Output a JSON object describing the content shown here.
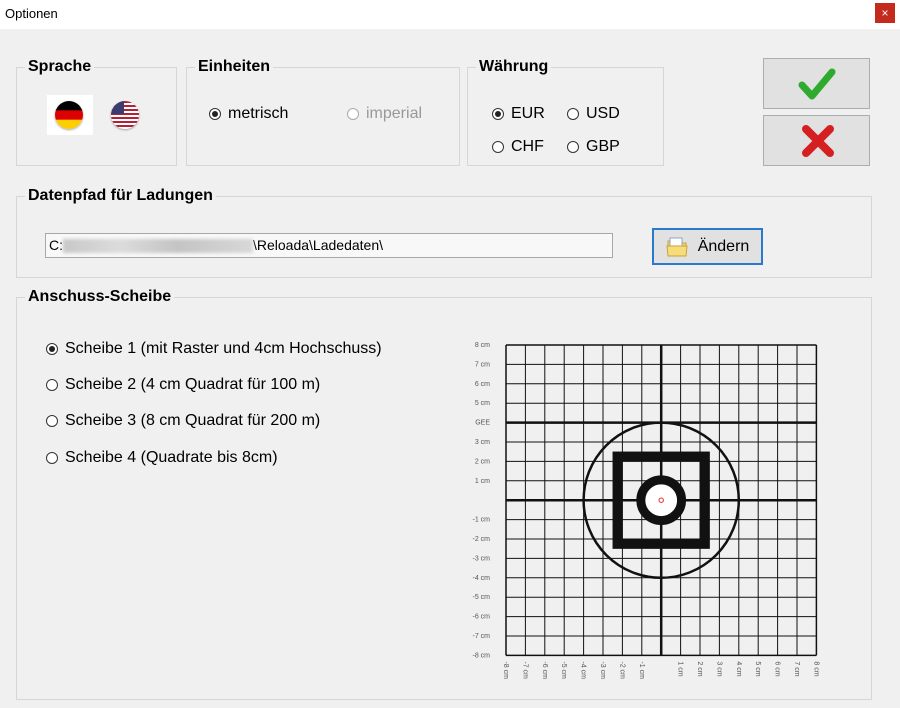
{
  "window": {
    "title": "Optionen",
    "close_glyph": "×"
  },
  "language": {
    "title": "Sprache",
    "flags": [
      {
        "name": "german-flag-icon",
        "colors": [
          "#000000",
          "#dd0000",
          "#ffce00"
        ]
      },
      {
        "name": "us-flag-icon",
        "colors": [
          "#b22234",
          "#ffffff",
          "#3c3b6e"
        ]
      }
    ]
  },
  "units": {
    "title": "Einheiten",
    "options": [
      {
        "label": "metrisch",
        "checked": true,
        "enabled": true
      },
      {
        "label": "imperial",
        "checked": false,
        "enabled": false
      }
    ]
  },
  "currency": {
    "title": "Währung",
    "options": [
      {
        "label": "EUR",
        "checked": true
      },
      {
        "label": "USD",
        "checked": false
      },
      {
        "label": "CHF",
        "checked": false
      },
      {
        "label": "GBP",
        "checked": false
      }
    ]
  },
  "actions": {
    "ok_icon": "checkmark-icon",
    "ok_color": "#2eaa2e",
    "cancel_icon": "x-icon",
    "cancel_color": "#d42020"
  },
  "datapath": {
    "title": "Datenpfad für Ladungen",
    "path_prefix": "C:",
    "path_suffix": "\\Reloada\\Ladedaten\\",
    "change_label": "Ändern",
    "change_icon": "folder-icon"
  },
  "target": {
    "title": "Anschuss-Scheibe",
    "options": [
      {
        "label": "Scheibe 1 (mit Raster und 4cm Hochschuss)",
        "checked": true
      },
      {
        "label": "Scheibe 2 (4 cm Quadrat für 100 m)",
        "checked": false
      },
      {
        "label": "Scheibe 3 (8 cm Quadrat für 200 m)",
        "checked": false
      },
      {
        "label": "Scheibe 4 (Quadrate bis 8cm)",
        "checked": false
      }
    ],
    "preview": {
      "y_labels": [
        "8 cm",
        "7 cm",
        "6 cm",
        "5 cm",
        "GEE",
        "3 cm",
        "2 cm",
        "1 cm",
        "",
        "-1 cm",
        "-2 cm",
        "-3 cm",
        "-4 cm",
        "-5 cm",
        "-6 cm",
        "-7 cm",
        "-8 cm"
      ],
      "x_labels": [
        "-8 cm",
        "-7 cm",
        "-6 cm",
        "-5 cm",
        "-4 cm",
        "-3 cm",
        "-2 cm",
        "-1 cm",
        "",
        "1 cm",
        "2 cm",
        "3 cm",
        "4 cm",
        "5 cm",
        "6 cm",
        "7 cm",
        "8 cm"
      ],
      "center_dot_color": "#e03030"
    }
  }
}
